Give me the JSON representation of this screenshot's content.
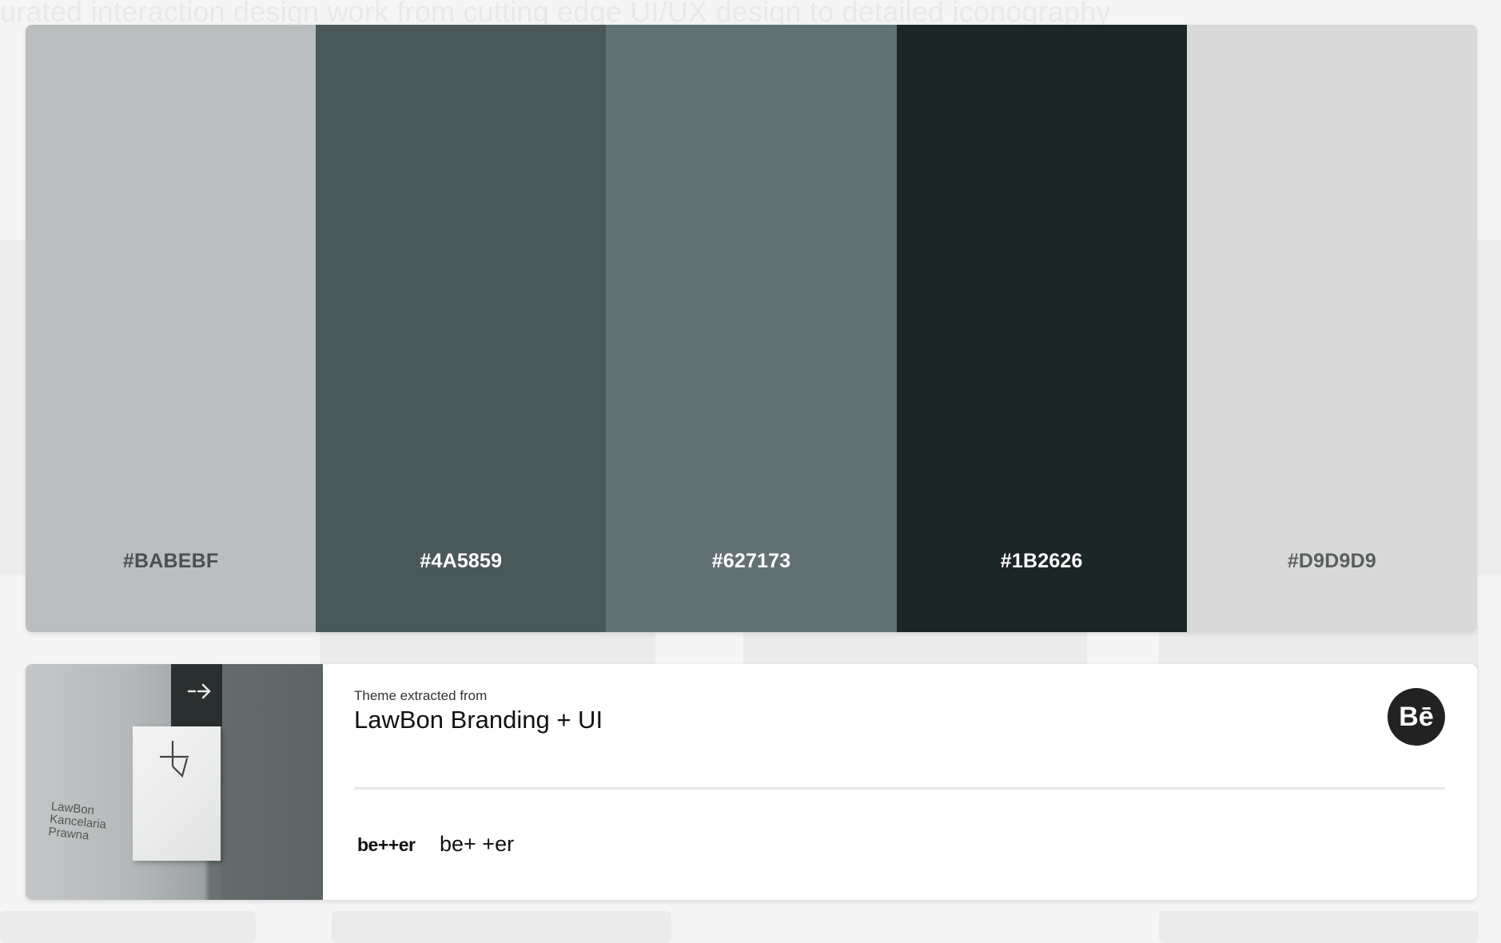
{
  "background": {
    "text": "urated interaction design work from cutting edge UI/UX design to detailed iconography"
  },
  "palette": {
    "swatches": [
      {
        "hex": "#BABEBF",
        "color": "#BABEBF",
        "label_color": "#4a4f50"
      },
      {
        "hex": "#4A5859",
        "color": "#4A5859",
        "label_color": "#ffffff"
      },
      {
        "hex": "#627173",
        "color": "#627173",
        "label_color": "#ffffff"
      },
      {
        "hex": "#1B2626",
        "color": "#1B2626",
        "label_color": "#ffffff"
      },
      {
        "hex": "#D9D9D9",
        "color": "#D9D9D9",
        "label_color": "#5a5e5f"
      }
    ]
  },
  "info": {
    "extracted_label": "Theme extracted from",
    "project_title": "LawBon Branding + UI",
    "thumbnail_text": "LawBon\nKancelaria\nPrawna",
    "behance_icon": "Bē",
    "owner_logo": "be++er",
    "owner_name": "be+ +er"
  }
}
